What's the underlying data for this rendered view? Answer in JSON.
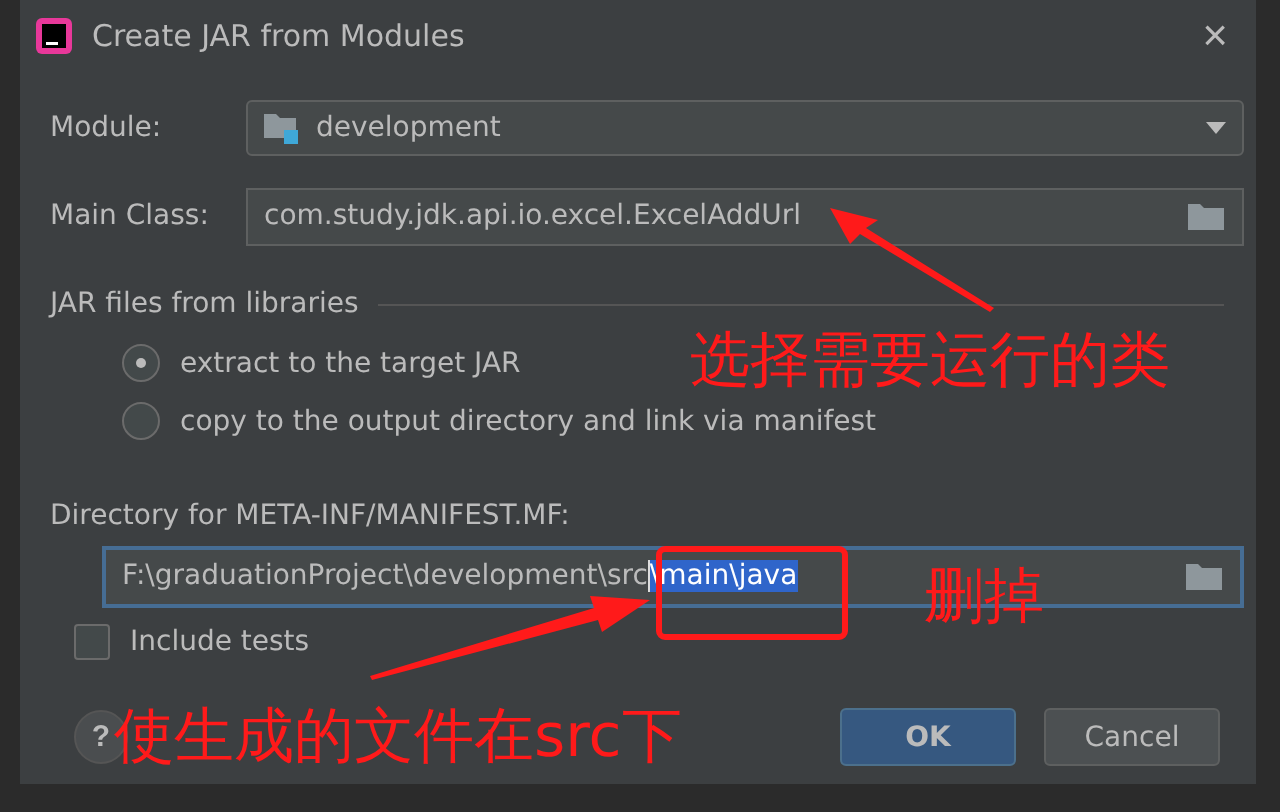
{
  "window": {
    "title": "Create JAR from Modules",
    "close": "×"
  },
  "module": {
    "label": "Module:",
    "value": "development"
  },
  "main_class": {
    "label": "Main Class:",
    "value": "com.study.jdk.api.io.excel.ExcelAddUrl"
  },
  "libraries": {
    "title": "JAR files from libraries",
    "options": [
      {
        "label": "extract to the target JAR",
        "selected": true
      },
      {
        "label": "copy to the output directory and link via manifest",
        "selected": false
      }
    ]
  },
  "manifest": {
    "label": "Directory for META-INF/MANIFEST.MF:",
    "value": "F:\\graduationProject\\development\\src",
    "selected_text": "\\main\\java"
  },
  "include_tests": {
    "label": "Include tests",
    "checked": false
  },
  "help": "?",
  "buttons": [
    {
      "label": "OK",
      "kind": "primary"
    },
    {
      "label": "Cancel",
      "kind": "secondary"
    }
  ],
  "annotations": {
    "main_class_note": "选择需要运行的类",
    "delete_note": "删掉",
    "src_note": "使生成的文件在src下"
  }
}
